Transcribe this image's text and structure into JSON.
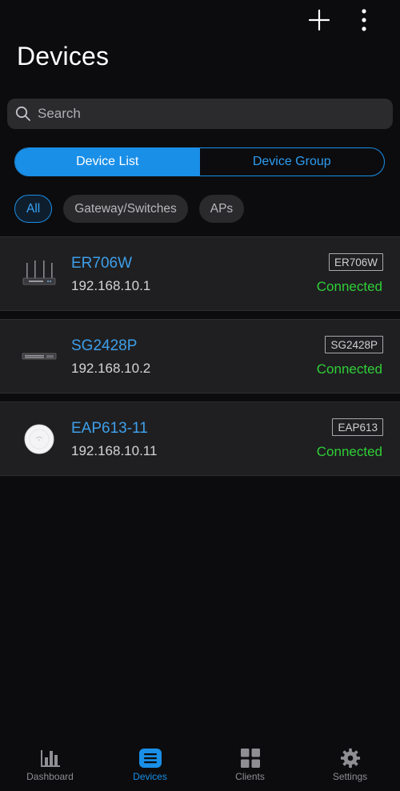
{
  "header": {
    "title": "Devices",
    "add_icon": "plus-icon",
    "more_icon": "more-vertical-icon"
  },
  "search": {
    "placeholder": "Search",
    "value": "",
    "icon": "search-icon"
  },
  "segments": [
    {
      "label": "Device List",
      "active": true
    },
    {
      "label": "Device Group",
      "active": false
    }
  ],
  "filters": [
    {
      "label": "All",
      "active": true
    },
    {
      "label": "Gateway/Switches",
      "active": false
    },
    {
      "label": "APs",
      "active": false
    }
  ],
  "devices": [
    {
      "name": "ER706W",
      "ip": "192.168.10.1",
      "model": "ER706W",
      "status": "Connected",
      "icon": "router-icon"
    },
    {
      "name": "SG2428P",
      "ip": "192.168.10.2",
      "model": "SG2428P",
      "status": "Connected",
      "icon": "switch-icon"
    },
    {
      "name": "EAP613-11",
      "ip": "192.168.10.11",
      "model": "EAP613",
      "status": "Connected",
      "icon": "access-point-icon"
    }
  ],
  "tabbar": {
    "tabs": [
      {
        "label": "Dashboard",
        "icon": "bar-chart-icon",
        "active": false
      },
      {
        "label": "Devices",
        "icon": "devices-list-icon",
        "active": true
      },
      {
        "label": "Clients",
        "icon": "grid-icon",
        "active": false
      },
      {
        "label": "Settings",
        "icon": "gear-icon",
        "active": false
      }
    ]
  },
  "colors": {
    "accent": "#1a8fe8",
    "connected": "#2fcf37",
    "background": "#0c0c0e",
    "card": "#1f1f21"
  }
}
